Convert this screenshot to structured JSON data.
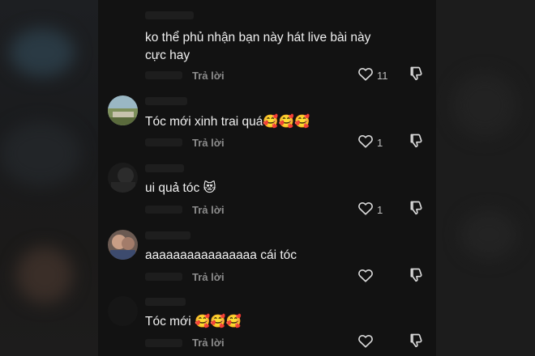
{
  "comments": [
    {
      "text": "ko thể phủ nhận bạn này hát live bài này cực hay",
      "reply_label": "Trả lời",
      "likes": "11"
    },
    {
      "text": "Tóc mới xinh trai quá🥰🥰🥰",
      "reply_label": "Trả lời",
      "likes": "1"
    },
    {
      "text": "ui quả tóc 😻",
      "reply_label": "Trả lời",
      "likes": "1"
    },
    {
      "text": "aaaaaaaaaaaaaaaa cái tóc",
      "reply_label": "Trả lời",
      "likes": ""
    },
    {
      "text": "Tóc mới 🥰🥰🥰",
      "reply_label": "Trả lời",
      "likes": ""
    }
  ],
  "icons": {
    "like": "heart-outline-icon",
    "dislike": "thumbs-down-outline-icon"
  },
  "colors": {
    "panel_background": "#121212",
    "text": "#f0f0f0",
    "reply": "#8c8c8c"
  }
}
